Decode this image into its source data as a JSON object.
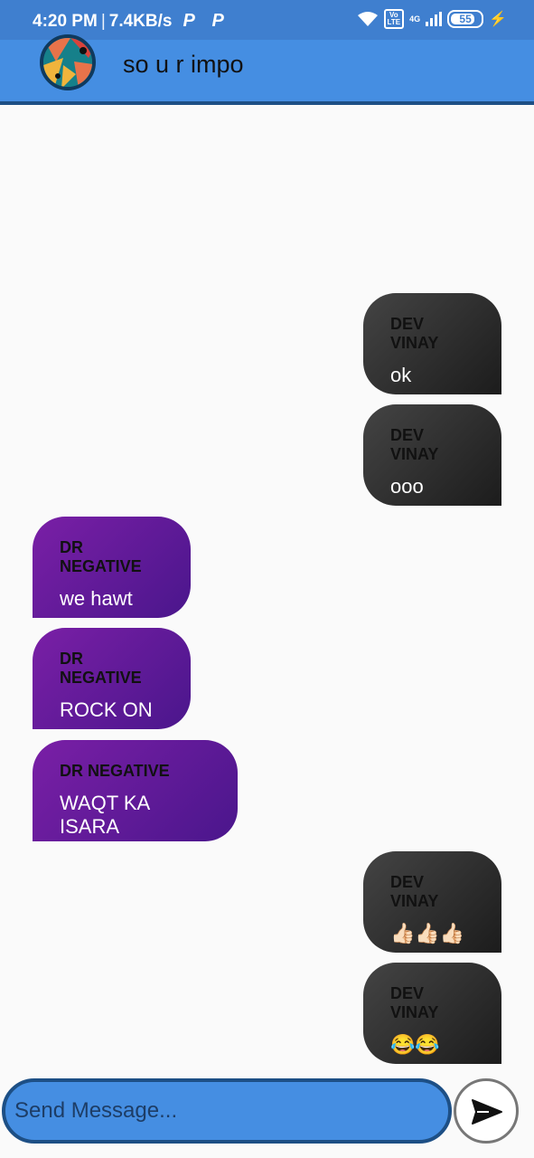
{
  "status_bar": {
    "time": "4:20 PM",
    "speed": "7.4KB/s",
    "network": "4G",
    "battery": "55"
  },
  "app_bar": {
    "title": "so u r impo"
  },
  "messages": [
    {
      "sender": "DEV VINAY",
      "text": "ok",
      "side": "right"
    },
    {
      "sender": "DEV VINAY",
      "text": "ooo",
      "side": "right"
    },
    {
      "sender": "DR NEGATIVE",
      "text": "we hawt",
      "side": "left"
    },
    {
      "sender": "DR NEGATIVE",
      "text": "ROCK ON",
      "side": "left"
    },
    {
      "sender": "DR NEGATIVE",
      "text": "WAQT KA ISARA",
      "side": "left"
    },
    {
      "sender": "DEV VINAY",
      "text": "👍🏻👍🏻👍🏻",
      "side": "right"
    },
    {
      "sender": "DEV VINAY",
      "text": "😂😂",
      "side": "right"
    }
  ],
  "composer": {
    "placeholder": "Send Message..."
  },
  "colors": {
    "app_bar": "#458ee2",
    "status_bar": "#3f7fcf",
    "outgoing_bubble": "#2b2b2b",
    "incoming_bubble": "#6a1b9a"
  }
}
